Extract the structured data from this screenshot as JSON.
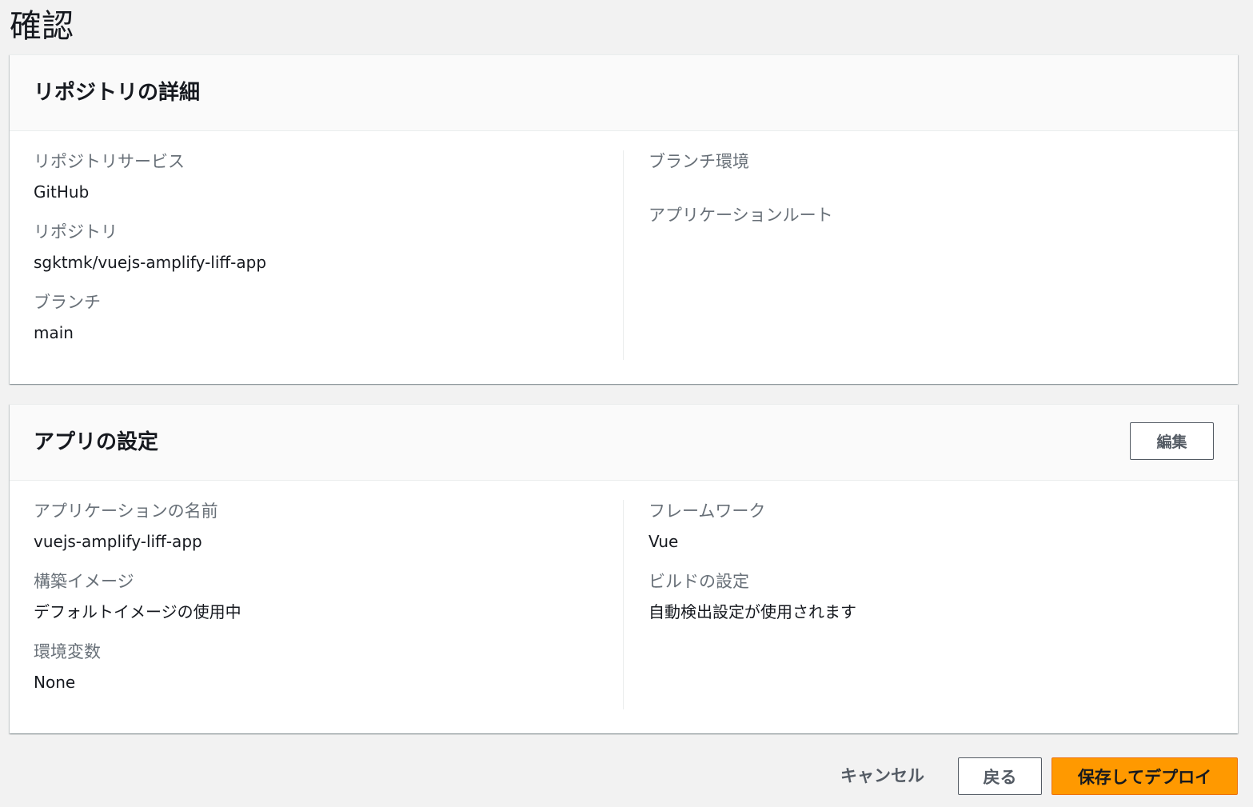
{
  "page": {
    "title": "確認"
  },
  "repository_details": {
    "heading": "リポジトリの詳細",
    "left": [
      {
        "label": "リポジトリサービス",
        "value": "GitHub"
      },
      {
        "label": "リポジトリ",
        "value": "sgktmk/vuejs-amplify-liff-app"
      },
      {
        "label": "ブランチ",
        "value": "main"
      }
    ],
    "right": [
      {
        "label": "ブランチ環境",
        "value": ""
      },
      {
        "label": "アプリケーションルート",
        "value": ""
      }
    ]
  },
  "app_settings": {
    "heading": "アプリの設定",
    "edit_label": "編集",
    "left": [
      {
        "label": "アプリケーションの名前",
        "value": "vuejs-amplify-liff-app"
      },
      {
        "label": "構築イメージ",
        "value": "デフォルトイメージの使用中"
      },
      {
        "label": "環境変数",
        "value": "None"
      }
    ],
    "right": [
      {
        "label": "フレームワーク",
        "value": "Vue"
      },
      {
        "label": "ビルドの設定",
        "value": "自動検出設定が使用されます"
      }
    ]
  },
  "actions": {
    "cancel_label": "キャンセル",
    "back_label": "戻る",
    "deploy_label": "保存してデプロイ"
  },
  "colors": {
    "primary_button": "#ff9900",
    "page_background": "#f2f2f2"
  }
}
